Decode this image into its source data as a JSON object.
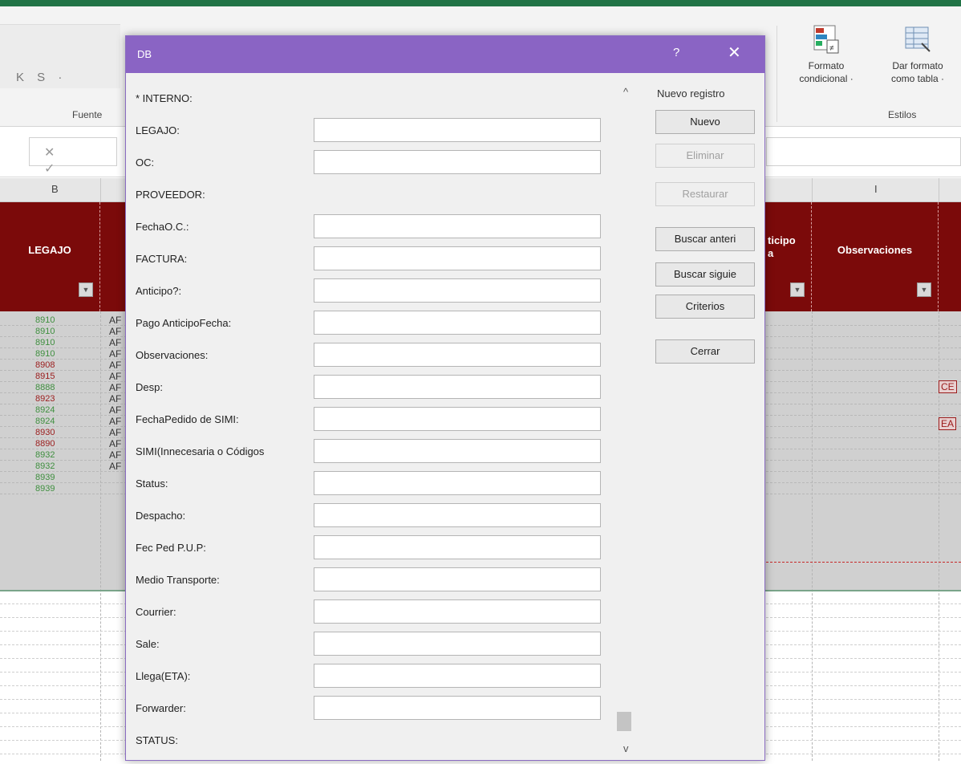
{
  "excel": {
    "ribbon": {
      "fuente_label": "Fuente",
      "font_glyphs": "K S ·",
      "formato_condicional": [
        "Formato",
        "condicional ·"
      ],
      "dar_formato": [
        "Dar formato",
        "como tabla ·"
      ],
      "estilos_label": "Estilos"
    },
    "formula_bar": {
      "cancel_enter": "✕ ✓"
    },
    "column_letters": {
      "b": "B",
      "i": "I"
    },
    "header_row": {
      "legajo": "LEGAJO",
      "anticipo": [
        "ticipo",
        "a"
      ],
      "observaciones": "Observaciones"
    },
    "ar_text": "AF",
    "rows": [
      {
        "legajo": "8910",
        "color": "#3f8f3f"
      },
      {
        "legajo": "8910",
        "color": "#3f8f3f"
      },
      {
        "legajo": "8910",
        "color": "#3f8f3f"
      },
      {
        "legajo": "8910",
        "color": "#3f8f3f"
      },
      {
        "legajo": "8908",
        "color": "#9b1c1c"
      },
      {
        "legajo": "8915",
        "color": "#9b1c1c"
      },
      {
        "legajo": "8888",
        "color": "#3f8f3f"
      },
      {
        "legajo": "8923",
        "color": "#9b1c1c"
      },
      {
        "legajo": "8924",
        "color": "#3f8f3f"
      },
      {
        "legajo": "8924",
        "color": "#3f8f3f"
      },
      {
        "legajo": "8930",
        "color": "#9b1c1c"
      },
      {
        "legajo": "8890",
        "color": "#9b1c1c"
      },
      {
        "legajo": "8932",
        "color": "#3f8f3f"
      },
      {
        "legajo": "8932",
        "color": "#3f8f3f"
      },
      {
        "legajo": "8939",
        "color": "#3f8f3f"
      },
      {
        "legajo": "8939",
        "color": "#3f8f3f"
      }
    ],
    "outline_cells": [
      "CE",
      "EA"
    ]
  },
  "dialog": {
    "title": "DB",
    "help": "?",
    "close": "✕",
    "record_label": "Nuevo registro",
    "scroll_up": "^",
    "scroll_down": "v",
    "fields": [
      {
        "label": "* INTERNO:",
        "input": false
      },
      {
        "label": "LEGAJO:",
        "input": true
      },
      {
        "label": "OC:",
        "input": true
      },
      {
        "label": "PROVEEDOR:",
        "input": false
      },
      {
        "label": "FechaO.C.:",
        "input": true
      },
      {
        "label": "FACTURA:",
        "input": true
      },
      {
        "label": "Anticipo?:",
        "input": true
      },
      {
        "label": "Pago AnticipoFecha:",
        "input": true
      },
      {
        "label": "Observaciones:",
        "input": true
      },
      {
        "label": "Desp:",
        "input": true
      },
      {
        "label": "FechaPedido de SIMI:",
        "input": true
      },
      {
        "label": "SIMI(Innecesaria o Códigos",
        "input": true
      },
      {
        "label": "Status:",
        "input": true
      },
      {
        "label": "Despacho:",
        "input": true
      },
      {
        "label": "Fec Ped P.U.P:",
        "input": true
      },
      {
        "label": "Medio Transporte:",
        "input": true
      },
      {
        "label": "Courrier:",
        "input": true
      },
      {
        "label": "Sale:",
        "input": true
      },
      {
        "label": "Llega(ETA):",
        "input": true
      },
      {
        "label": "Forwarder:",
        "input": true
      },
      {
        "label": "STATUS:",
        "input": false
      }
    ],
    "buttons": [
      {
        "label": "Nuevo",
        "disabled": false,
        "name": "nuevo-button"
      },
      {
        "label": "Eliminar",
        "disabled": true,
        "name": "eliminar-button"
      },
      {
        "label": "Restaurar",
        "disabled": true,
        "name": "restaurar-button"
      },
      {
        "label": "Buscar anteri",
        "disabled": false,
        "name": "buscar-anterior-button"
      },
      {
        "label": "Buscar siguie",
        "disabled": false,
        "name": "buscar-siguiente-button"
      },
      {
        "label": "Criterios",
        "disabled": false,
        "name": "criterios-button"
      },
      {
        "label": "Cerrar",
        "disabled": false,
        "name": "cerrar-button"
      }
    ]
  }
}
